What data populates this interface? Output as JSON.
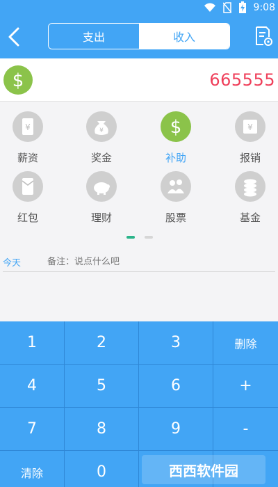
{
  "status_bar": {
    "time": "9:08"
  },
  "header": {
    "tabs": [
      {
        "label": "支出"
      },
      {
        "label": "收入"
      }
    ]
  },
  "amount": {
    "value": "665555"
  },
  "categories": [
    {
      "label": "薪资",
      "icon": "yen-icon",
      "active": false
    },
    {
      "label": "奖金",
      "icon": "money-bag-icon",
      "active": false
    },
    {
      "label": "补助",
      "icon": "dollar-icon",
      "active": true
    },
    {
      "label": "报销",
      "icon": "yen-icon",
      "active": false
    },
    {
      "label": "红包",
      "icon": "red-envelope-icon",
      "active": false
    },
    {
      "label": "理财",
      "icon": "piggy-bank-icon",
      "active": false
    },
    {
      "label": "股票",
      "icon": "people-chart-icon",
      "active": false
    },
    {
      "label": "基金",
      "icon": "coins-icon",
      "active": false
    }
  ],
  "note_row": {
    "date": "今天",
    "placeholder": "备注：说点什么吧"
  },
  "keypad": {
    "keys": [
      "1",
      "2",
      "3",
      "删除",
      "4",
      "5",
      "6",
      "+",
      "7",
      "8",
      "9",
      "-",
      "清除",
      "0",
      "",
      ""
    ]
  },
  "watermark": {
    "text": "西西软件园"
  },
  "colors": {
    "primary": "#42a5f5",
    "accent_green": "#8bc34a",
    "amount_red": "#ef3f5a"
  }
}
